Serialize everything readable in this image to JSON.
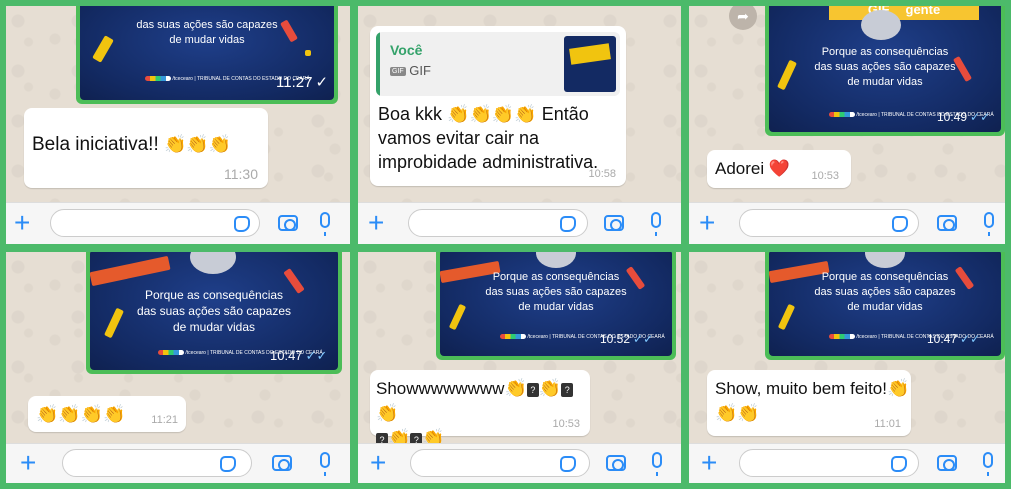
{
  "poster": {
    "line1": "Porque as consequências",
    "line2": "das suas ações são capazes",
    "line3": "de mudar vidas",
    "org": "/tcecearo",
    "court": "TRIBUNAL DE CONTAS DO ESTADO DO CEARÁ",
    "gif_label": "GIF",
    "banner_text": "gente"
  },
  "panels": [
    {
      "gif_time": "11:27",
      "message": "Bela iniciativa!!",
      "emoji": "👏👏👏",
      "time": "11:30"
    },
    {
      "reply_author": "Você",
      "reply_type": "GIF",
      "message_line1": "Boa kkk",
      "emoji": "👏👏👏👏",
      "message_line1b": "Então",
      "message_line2": "vamos evitar cair na",
      "message_line3": "improbidade administrativa.",
      "time": "10:58"
    },
    {
      "gif_time": "10:49",
      "message": "Adorei",
      "emoji": "❤️",
      "time": "10:53"
    },
    {
      "gif_time": "10:47",
      "emoji": "👏👏👏👏",
      "time": "11:21"
    },
    {
      "gif_time": "10:52",
      "message": "Showwwwwwww",
      "line1_tail": "👏",
      "line2": "👏",
      "time": "10:53"
    },
    {
      "gif_time": "10:47",
      "message": "Show, muito bem feito!",
      "emoji_tail": "👏",
      "emoji_line2": "👏👏",
      "time": "11:01"
    }
  ],
  "colors": {
    "frame_green": "#4cba6a",
    "accent_blue": "#2b8cf7",
    "poster_navy": "#132a63"
  }
}
